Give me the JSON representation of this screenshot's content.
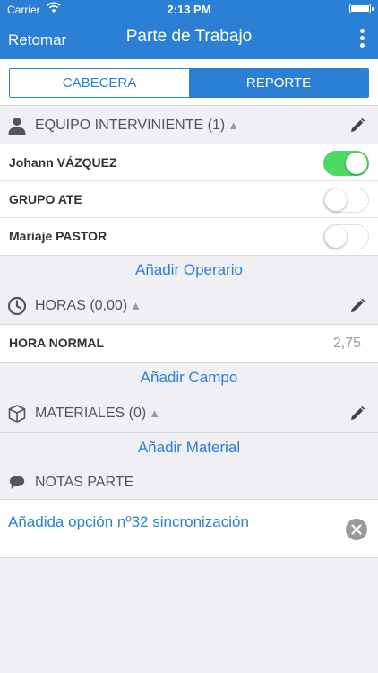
{
  "status_bar": {
    "carrier": "Carrier",
    "time": "2:13 PM"
  },
  "nav": {
    "back_label": "Retomar",
    "title": "Parte de Trabajo",
    "more_icon": "more-vertical-icon"
  },
  "tabs": [
    {
      "label": "CABECERA",
      "selected": false
    },
    {
      "label": "REPORTE",
      "selected": true
    }
  ],
  "equipo": {
    "title": "EQUIPO INTERVINIENTE (1)",
    "icon": "person-icon",
    "members": [
      {
        "name": "Johann VÁZQUEZ",
        "enabled": true
      },
      {
        "name": "GRUPO ATE",
        "enabled": false
      },
      {
        "name": "Mariaje PASTOR",
        "enabled": false
      }
    ],
    "add_label": "Añadir Operario"
  },
  "horas": {
    "title": "HORAS (0,00)",
    "icon": "clock-icon",
    "rows": [
      {
        "label": "HORA NORMAL",
        "value": "2,75"
      }
    ],
    "add_label": "Añadir Campo"
  },
  "materiales": {
    "title": "MATERIALES (0)",
    "icon": "box-icon",
    "add_label": "Añadir Material"
  },
  "notas": {
    "title": "NOTAS PARTE",
    "icon": "speech-bubble-icon",
    "text": "Añadida opción nº32 sincronización"
  },
  "colors": {
    "accent": "#2b7fd4",
    "toggle_on": "#4cd964",
    "background": "#efeff4"
  }
}
